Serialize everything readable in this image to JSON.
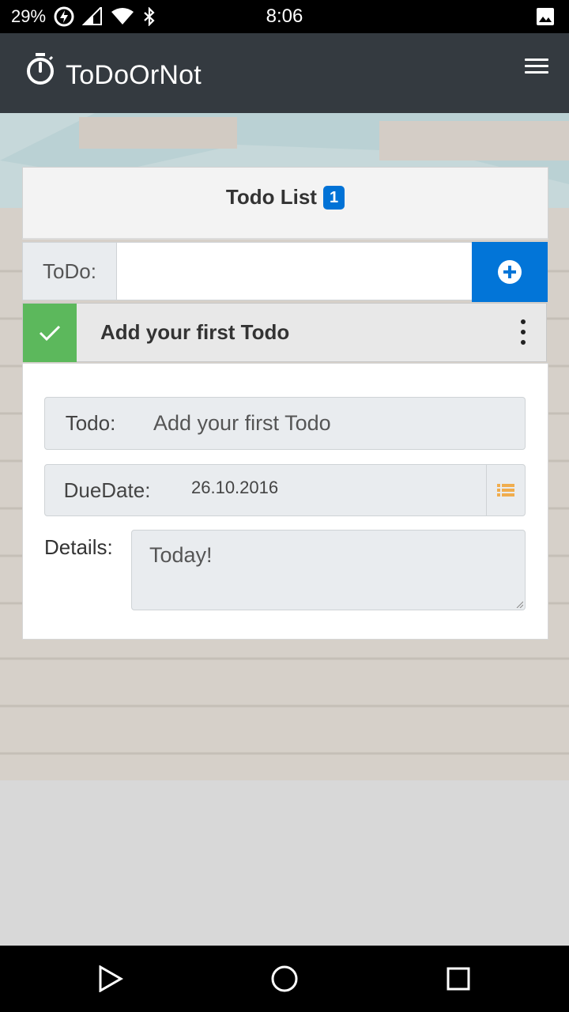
{
  "status_bar": {
    "battery": "29%",
    "time": "8:06"
  },
  "app_bar": {
    "title": "ToDoOrNot",
    "logo_icon": "stopwatch-icon",
    "menu_icon": "hamburger-menu-icon"
  },
  "todo_list": {
    "title": "Todo List",
    "count": "1",
    "new_todo_label": "ToDo:",
    "new_todo_value": "",
    "add_icon": "plus-circle-icon"
  },
  "items": [
    {
      "title": "Add your first Todo",
      "done_icon": "checkmark-icon",
      "menu_icon": "more-vertical-icon"
    }
  ],
  "detail": {
    "todo_label": "Todo:",
    "todo_value": "Add your first Todo",
    "due_label": "DueDate:",
    "due_value": "26.10.2016",
    "calendar_icon": "list-calendar-icon",
    "details_label": "Details:",
    "details_value": "Today!"
  },
  "colors": {
    "app_bar": "#343a40",
    "primary": "#0275d8",
    "success": "#5cb85c",
    "calendar_icon": "#f0ad4e"
  }
}
